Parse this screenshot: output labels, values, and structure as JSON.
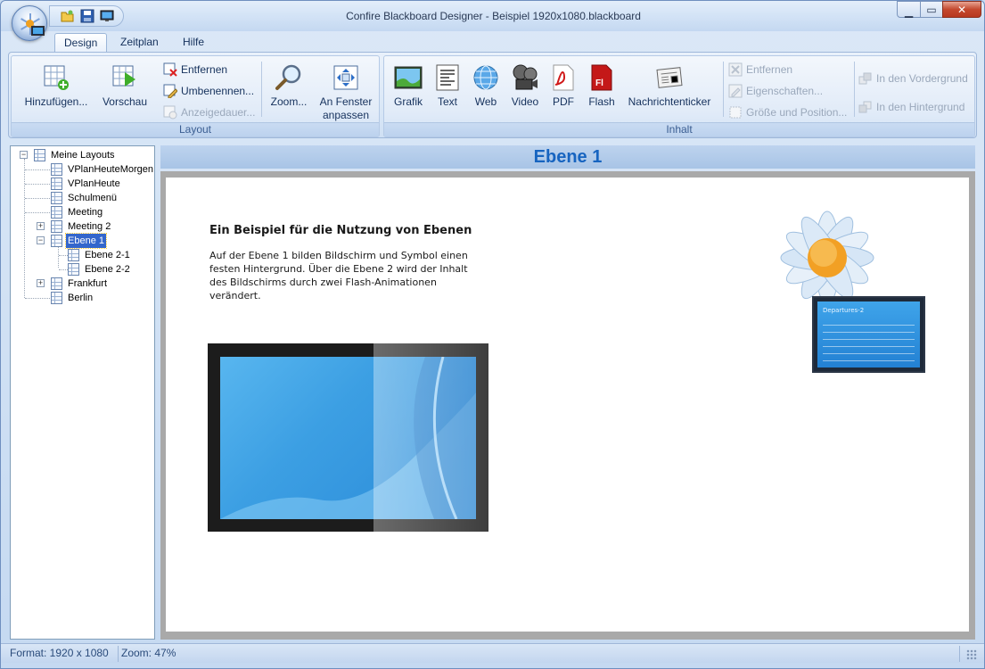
{
  "window": {
    "title": "Confire Blackboard Designer - Beispiel 1920x1080.blackboard",
    "controls": [
      "minimize",
      "maximize",
      "close"
    ]
  },
  "quick_access": [
    {
      "name": "open-icon"
    },
    {
      "name": "save-icon"
    },
    {
      "name": "preview-screen-icon"
    }
  ],
  "tabs": [
    {
      "label": "Design",
      "active": true
    },
    {
      "label": "Zeitplan",
      "active": false
    },
    {
      "label": "Hilfe",
      "active": false
    }
  ],
  "ribbon": {
    "layout_group": {
      "label": "Layout",
      "add": "Hinzufügen...",
      "preview": "Vorschau",
      "remove": "Entfernen",
      "rename": "Umbenennen...",
      "duration": "Anzeigedauer...",
      "zoom": "Zoom...",
      "fit_line1": "An Fenster",
      "fit_line2": "anpassen"
    },
    "content_group": {
      "label": "Inhalt",
      "graphic": "Grafik",
      "text": "Text",
      "web": "Web",
      "video": "Video",
      "pdf": "PDF",
      "flash": "Flash",
      "news": "Nachrichtenticker",
      "remove": "Entfernen",
      "properties": "Eigenschaften...",
      "size_position": "Größe und Position...",
      "bring_front": "In den Vordergrund",
      "send_back": "In den Hintergrund"
    }
  },
  "tree": {
    "root": "Meine Layouts",
    "items": [
      {
        "label": "VPlanHeuteMorgen"
      },
      {
        "label": "VPlanHeute"
      },
      {
        "label": "Schulmenü"
      },
      {
        "label": "Meeting"
      },
      {
        "label": "Meeting 2"
      },
      {
        "label": "Ebene 1"
      },
      {
        "label": "Ebene 2-1"
      },
      {
        "label": "Ebene 2-2"
      },
      {
        "label": "Frankfurt"
      },
      {
        "label": "Berlin"
      }
    ],
    "selected": "Ebene 1"
  },
  "main": {
    "header": "Ebene 1",
    "heading": "Ein Beispiel für die Nutzung von Ebenen",
    "body_lines": [
      "Auf der Ebene 1 bilden Bildschirm und Symbol einen",
      "festen Hintergrund. Über die Ebene 2 wird der Inhalt",
      "des Bildschirms durch zwei Flash-Animationen",
      "verändert."
    ],
    "mini_screen_title": "Departures-2"
  },
  "status": {
    "format": "Format: 1920 x 1080",
    "zoom": "Zoom: 47%"
  },
  "colors": {
    "accent": "#1764c0",
    "selection": "#3366cc",
    "canvas_frame": "#a9a9a9"
  }
}
